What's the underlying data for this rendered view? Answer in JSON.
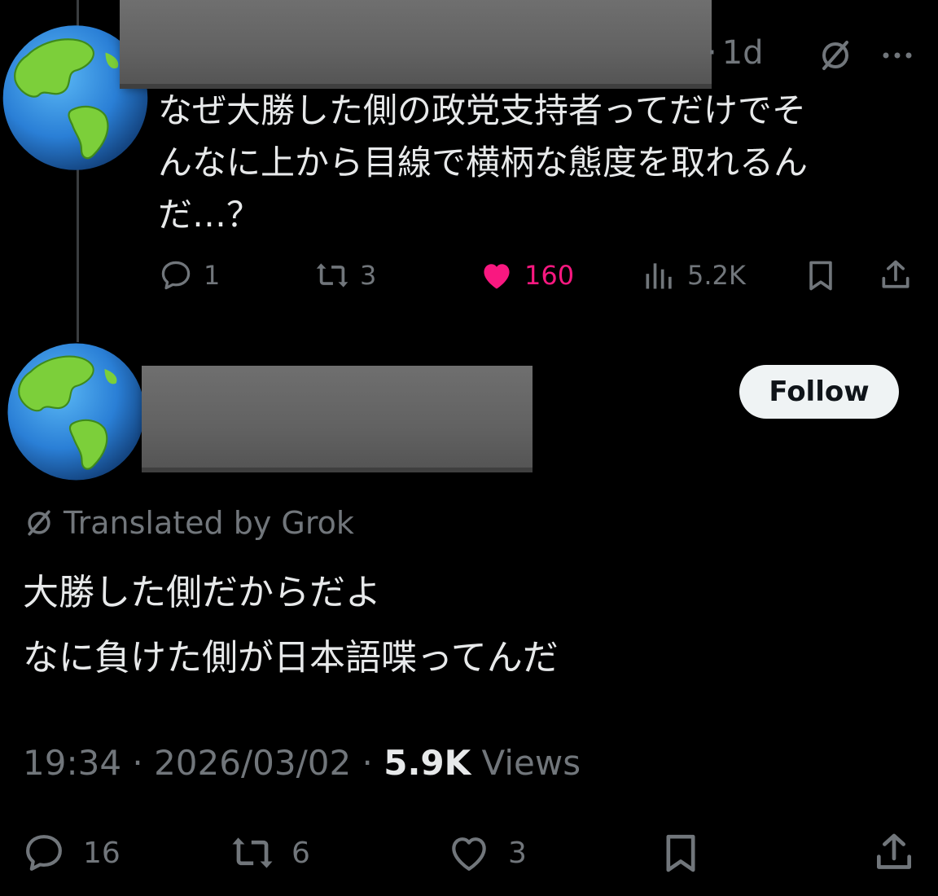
{
  "reply": {
    "time": "1d",
    "text_lines": [
      "なぜ大勝した側の政党支持者ってだけでそ",
      "んなに上から目線で横柄な態度を取れるん",
      "だ…？"
    ],
    "stats": {
      "replies": "1",
      "reposts": "3",
      "likes": "160",
      "views": "5.2K"
    },
    "icons": {
      "avatar": "earth-americas-icon",
      "grok": "grok-icon",
      "more": "more-icon"
    }
  },
  "main_post": {
    "follow_label": "Follow",
    "translated_label": "Translated by Grok",
    "text_lines": [
      "大勝した側だからだよ",
      "なに負けた側が日本語喋ってんだ"
    ],
    "timestamp": "19:34 · 2026/03/02 · ",
    "views_count": "5.9K",
    "views_label": " Views",
    "stats": {
      "replies": "16",
      "reposts": "6",
      "likes": "3"
    }
  },
  "colors": {
    "background": "#000000",
    "text": "#e7e9ea",
    "muted": "#71767b",
    "like_active": "#f91880"
  }
}
